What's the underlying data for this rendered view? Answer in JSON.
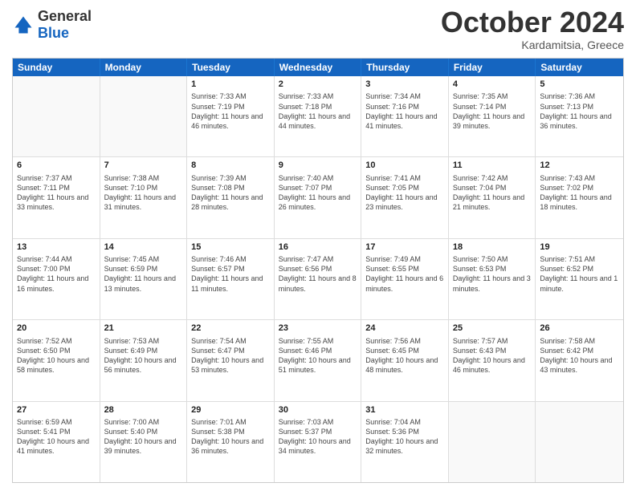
{
  "header": {
    "logo": {
      "general": "General",
      "blue": "Blue"
    },
    "title": "October 2024",
    "subtitle": "Kardamitsia, Greece"
  },
  "calendar": {
    "days_of_week": [
      "Sunday",
      "Monday",
      "Tuesday",
      "Wednesday",
      "Thursday",
      "Friday",
      "Saturday"
    ],
    "rows": [
      [
        {
          "day": "",
          "sunrise": "",
          "sunset": "",
          "daylight": "",
          "empty": true
        },
        {
          "day": "",
          "sunrise": "",
          "sunset": "",
          "daylight": "",
          "empty": true
        },
        {
          "day": "1",
          "sunrise": "Sunrise: 7:33 AM",
          "sunset": "Sunset: 7:19 PM",
          "daylight": "Daylight: 11 hours and 46 minutes.",
          "empty": false
        },
        {
          "day": "2",
          "sunrise": "Sunrise: 7:33 AM",
          "sunset": "Sunset: 7:18 PM",
          "daylight": "Daylight: 11 hours and 44 minutes.",
          "empty": false
        },
        {
          "day": "3",
          "sunrise": "Sunrise: 7:34 AM",
          "sunset": "Sunset: 7:16 PM",
          "daylight": "Daylight: 11 hours and 41 minutes.",
          "empty": false
        },
        {
          "day": "4",
          "sunrise": "Sunrise: 7:35 AM",
          "sunset": "Sunset: 7:14 PM",
          "daylight": "Daylight: 11 hours and 39 minutes.",
          "empty": false
        },
        {
          "day": "5",
          "sunrise": "Sunrise: 7:36 AM",
          "sunset": "Sunset: 7:13 PM",
          "daylight": "Daylight: 11 hours and 36 minutes.",
          "empty": false
        }
      ],
      [
        {
          "day": "6",
          "sunrise": "Sunrise: 7:37 AM",
          "sunset": "Sunset: 7:11 PM",
          "daylight": "Daylight: 11 hours and 33 minutes.",
          "empty": false
        },
        {
          "day": "7",
          "sunrise": "Sunrise: 7:38 AM",
          "sunset": "Sunset: 7:10 PM",
          "daylight": "Daylight: 11 hours and 31 minutes.",
          "empty": false
        },
        {
          "day": "8",
          "sunrise": "Sunrise: 7:39 AM",
          "sunset": "Sunset: 7:08 PM",
          "daylight": "Daylight: 11 hours and 28 minutes.",
          "empty": false
        },
        {
          "day": "9",
          "sunrise": "Sunrise: 7:40 AM",
          "sunset": "Sunset: 7:07 PM",
          "daylight": "Daylight: 11 hours and 26 minutes.",
          "empty": false
        },
        {
          "day": "10",
          "sunrise": "Sunrise: 7:41 AM",
          "sunset": "Sunset: 7:05 PM",
          "daylight": "Daylight: 11 hours and 23 minutes.",
          "empty": false
        },
        {
          "day": "11",
          "sunrise": "Sunrise: 7:42 AM",
          "sunset": "Sunset: 7:04 PM",
          "daylight": "Daylight: 11 hours and 21 minutes.",
          "empty": false
        },
        {
          "day": "12",
          "sunrise": "Sunrise: 7:43 AM",
          "sunset": "Sunset: 7:02 PM",
          "daylight": "Daylight: 11 hours and 18 minutes.",
          "empty": false
        }
      ],
      [
        {
          "day": "13",
          "sunrise": "Sunrise: 7:44 AM",
          "sunset": "Sunset: 7:00 PM",
          "daylight": "Daylight: 11 hours and 16 minutes.",
          "empty": false
        },
        {
          "day": "14",
          "sunrise": "Sunrise: 7:45 AM",
          "sunset": "Sunset: 6:59 PM",
          "daylight": "Daylight: 11 hours and 13 minutes.",
          "empty": false
        },
        {
          "day": "15",
          "sunrise": "Sunrise: 7:46 AM",
          "sunset": "Sunset: 6:57 PM",
          "daylight": "Daylight: 11 hours and 11 minutes.",
          "empty": false
        },
        {
          "day": "16",
          "sunrise": "Sunrise: 7:47 AM",
          "sunset": "Sunset: 6:56 PM",
          "daylight": "Daylight: 11 hours and 8 minutes.",
          "empty": false
        },
        {
          "day": "17",
          "sunrise": "Sunrise: 7:49 AM",
          "sunset": "Sunset: 6:55 PM",
          "daylight": "Daylight: 11 hours and 6 minutes.",
          "empty": false
        },
        {
          "day": "18",
          "sunrise": "Sunrise: 7:50 AM",
          "sunset": "Sunset: 6:53 PM",
          "daylight": "Daylight: 11 hours and 3 minutes.",
          "empty": false
        },
        {
          "day": "19",
          "sunrise": "Sunrise: 7:51 AM",
          "sunset": "Sunset: 6:52 PM",
          "daylight": "Daylight: 11 hours and 1 minute.",
          "empty": false
        }
      ],
      [
        {
          "day": "20",
          "sunrise": "Sunrise: 7:52 AM",
          "sunset": "Sunset: 6:50 PM",
          "daylight": "Daylight: 10 hours and 58 minutes.",
          "empty": false
        },
        {
          "day": "21",
          "sunrise": "Sunrise: 7:53 AM",
          "sunset": "Sunset: 6:49 PM",
          "daylight": "Daylight: 10 hours and 56 minutes.",
          "empty": false
        },
        {
          "day": "22",
          "sunrise": "Sunrise: 7:54 AM",
          "sunset": "Sunset: 6:47 PM",
          "daylight": "Daylight: 10 hours and 53 minutes.",
          "empty": false
        },
        {
          "day": "23",
          "sunrise": "Sunrise: 7:55 AM",
          "sunset": "Sunset: 6:46 PM",
          "daylight": "Daylight: 10 hours and 51 minutes.",
          "empty": false
        },
        {
          "day": "24",
          "sunrise": "Sunrise: 7:56 AM",
          "sunset": "Sunset: 6:45 PM",
          "daylight": "Daylight: 10 hours and 48 minutes.",
          "empty": false
        },
        {
          "day": "25",
          "sunrise": "Sunrise: 7:57 AM",
          "sunset": "Sunset: 6:43 PM",
          "daylight": "Daylight: 10 hours and 46 minutes.",
          "empty": false
        },
        {
          "day": "26",
          "sunrise": "Sunrise: 7:58 AM",
          "sunset": "Sunset: 6:42 PM",
          "daylight": "Daylight: 10 hours and 43 minutes.",
          "empty": false
        }
      ],
      [
        {
          "day": "27",
          "sunrise": "Sunrise: 6:59 AM",
          "sunset": "Sunset: 5:41 PM",
          "daylight": "Daylight: 10 hours and 41 minutes.",
          "empty": false
        },
        {
          "day": "28",
          "sunrise": "Sunrise: 7:00 AM",
          "sunset": "Sunset: 5:40 PM",
          "daylight": "Daylight: 10 hours and 39 minutes.",
          "empty": false
        },
        {
          "day": "29",
          "sunrise": "Sunrise: 7:01 AM",
          "sunset": "Sunset: 5:38 PM",
          "daylight": "Daylight: 10 hours and 36 minutes.",
          "empty": false
        },
        {
          "day": "30",
          "sunrise": "Sunrise: 7:03 AM",
          "sunset": "Sunset: 5:37 PM",
          "daylight": "Daylight: 10 hours and 34 minutes.",
          "empty": false
        },
        {
          "day": "31",
          "sunrise": "Sunrise: 7:04 AM",
          "sunset": "Sunset: 5:36 PM",
          "daylight": "Daylight: 10 hours and 32 minutes.",
          "empty": false
        },
        {
          "day": "",
          "sunrise": "",
          "sunset": "",
          "daylight": "",
          "empty": true
        },
        {
          "day": "",
          "sunrise": "",
          "sunset": "",
          "daylight": "",
          "empty": true
        }
      ]
    ]
  }
}
